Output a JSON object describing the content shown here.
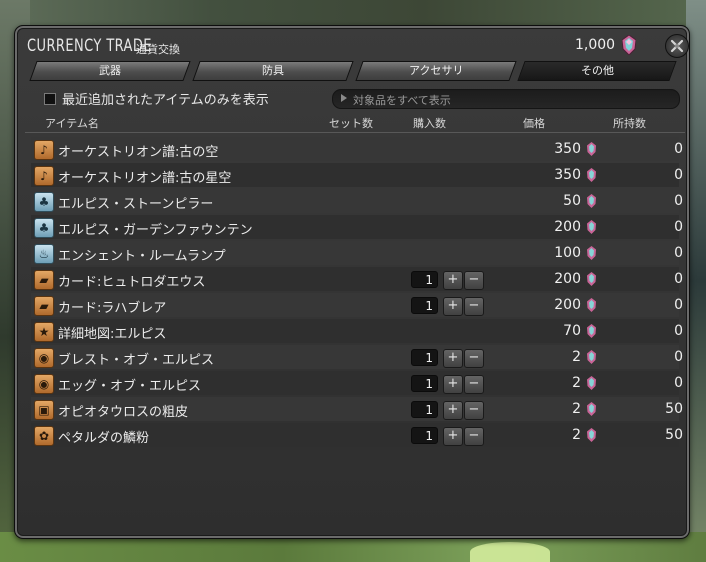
{
  "window": {
    "title": "CURRENCY TRADE",
    "subtitle": "通貨交換",
    "currency_amount": "1,000",
    "currency_icon": "gem-icon"
  },
  "tabs": [
    {
      "label": "武器",
      "active": false
    },
    {
      "label": "防具",
      "active": false
    },
    {
      "label": "アクセサリ",
      "active": false
    },
    {
      "label": "その他",
      "active": true
    }
  ],
  "filter": {
    "checkbox_label": "最近追加されたアイテムのみを表示",
    "checked": false,
    "search_placeholder": "対象品をすべて表示"
  },
  "columns": {
    "item": "アイテム名",
    "set_count": "セット数",
    "purchase_qty": "購入数",
    "price": "価格",
    "owned": "所持数"
  },
  "items": [
    {
      "name": "オーケストリオン譜:古の空",
      "icon": "music-note-icon",
      "icon_color": "orange",
      "qty": "",
      "price": "350",
      "owned": "0"
    },
    {
      "name": "オーケストリオン譜:古の星空",
      "icon": "music-note-icon",
      "icon_color": "orange",
      "qty": "",
      "price": "350",
      "owned": "0"
    },
    {
      "name": "エルピス・ストーンピラー",
      "icon": "furnishing-icon",
      "icon_color": "blue",
      "qty": "",
      "price": "50",
      "owned": "0"
    },
    {
      "name": "エルピス・ガーデンファウンテン",
      "icon": "furnishing-icon",
      "icon_color": "blue",
      "qty": "",
      "price": "200",
      "owned": "0"
    },
    {
      "name": "エンシェント・ルームランプ",
      "icon": "lamp-icon",
      "icon_color": "blue",
      "qty": "",
      "price": "100",
      "owned": "0"
    },
    {
      "name": "カード:ヒュトロダエウス",
      "icon": "card-icon",
      "icon_color": "orange",
      "qty": "1",
      "price": "200",
      "owned": "0"
    },
    {
      "name": "カード:ラハブレア",
      "icon": "card-icon",
      "icon_color": "orange",
      "qty": "1",
      "price": "200",
      "owned": "0"
    },
    {
      "name": "詳細地図:エルピス",
      "icon": "map-star-icon",
      "icon_color": "orange",
      "qty": "",
      "price": "70",
      "owned": "0"
    },
    {
      "name": "ブレスト・オブ・エルピス",
      "icon": "material-icon",
      "icon_color": "orange",
      "qty": "1",
      "price": "2",
      "owned": "0"
    },
    {
      "name": "エッグ・オブ・エルピス",
      "icon": "material-icon",
      "icon_color": "orange",
      "qty": "1",
      "price": "2",
      "owned": "0"
    },
    {
      "name": "オピオタウロスの粗皮",
      "icon": "leather-icon",
      "icon_color": "orange",
      "qty": "1",
      "price": "2",
      "owned": "50"
    },
    {
      "name": "ペタルダの鱗粉",
      "icon": "powder-icon",
      "icon_color": "orange",
      "qty": "1",
      "price": "2",
      "owned": "50"
    }
  ],
  "colors": {
    "window_bg": "#333333",
    "active_tab": "#1c1c1c",
    "tab_marker": "#e3c23b",
    "gem": "#e86aa0"
  }
}
